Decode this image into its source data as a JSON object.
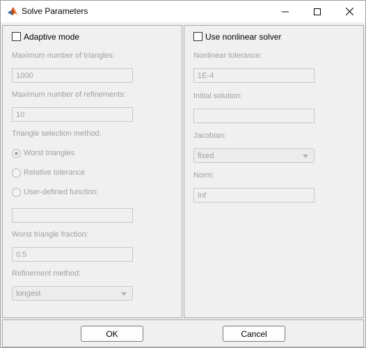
{
  "window": {
    "title": "Solve Parameters",
    "app_icon": "matlab-icon",
    "controls": [
      "minimize-icon",
      "maximize-icon",
      "close-icon"
    ]
  },
  "adaptive": {
    "checkbox_label": "Adaptive mode",
    "checked": false,
    "max_triangles_label": "Maximum number of triangles:",
    "max_triangles_value": "1000",
    "max_refinements_label": "Maximum number of refinements:",
    "max_refinements_value": "10",
    "selection_method_label": "Triangle selection method:",
    "selection_options": [
      "Worst triangles",
      "Relative tolerance",
      "User-defined function:"
    ],
    "selected_option": "Worst triangles",
    "user_function_value": "",
    "worst_fraction_label": "Worst triangle fraction:",
    "worst_fraction_value": "0.5",
    "refinement_method_label": "Refinement method:",
    "refinement_method_value": "longest"
  },
  "nonlinear": {
    "checkbox_label": "Use nonlinear solver",
    "checked": false,
    "tolerance_label": "Nonlinear tolerance:",
    "tolerance_value": "1E-4",
    "initial_solution_label": "Initial solution:",
    "initial_solution_value": "",
    "jacobian_label": "Jacobian:",
    "jacobian_value": "fixed",
    "norm_label": "Norm:",
    "norm_value": "Inf"
  },
  "footer": {
    "ok_label": "OK",
    "cancel_label": "Cancel"
  }
}
